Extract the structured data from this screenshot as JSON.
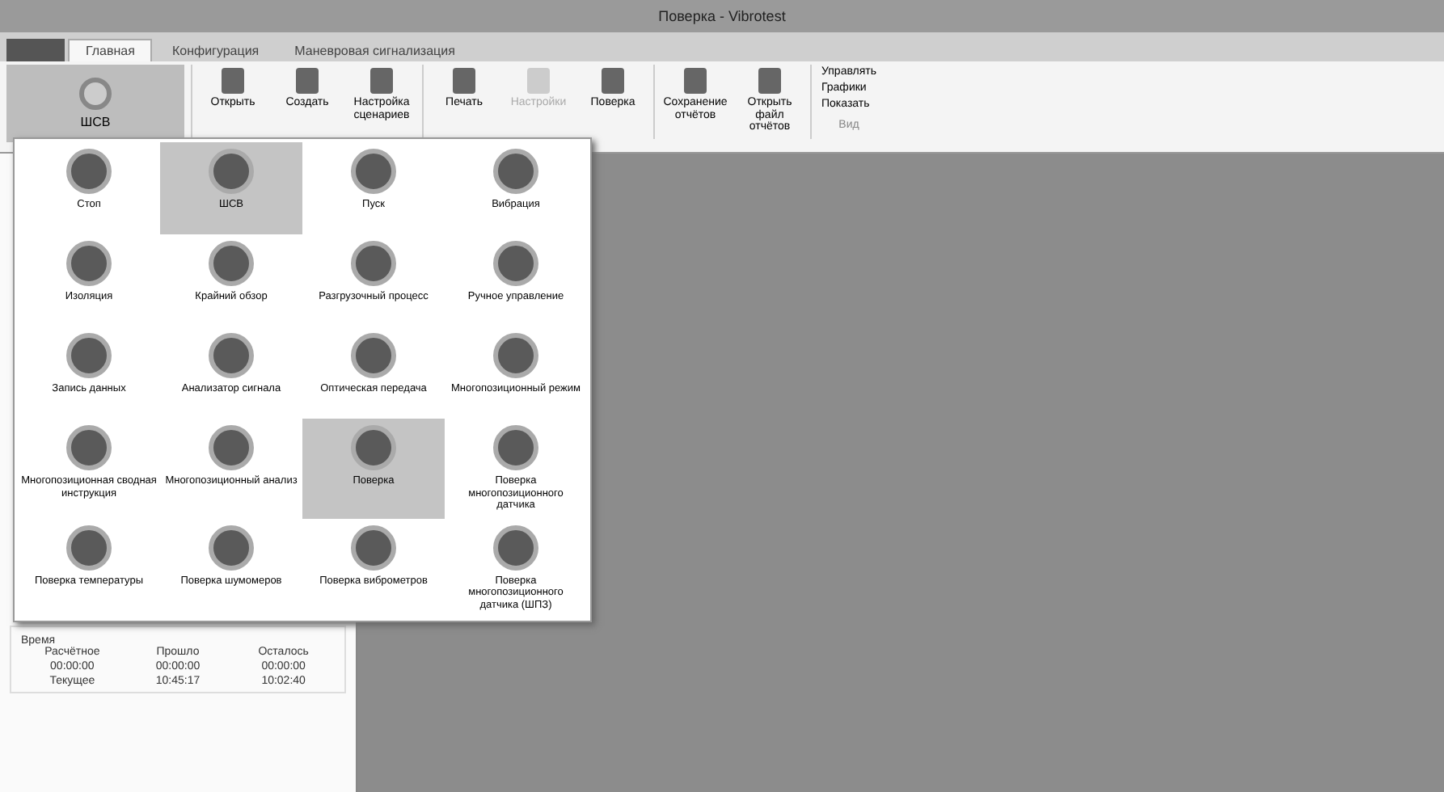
{
  "window": {
    "title": "Поверка - Vibrotest"
  },
  "tabs": [
    {
      "label": "Главная",
      "selected": true
    },
    {
      "label": "Конфигурация",
      "selected": false
    },
    {
      "label": "Маневровая сигнализация",
      "selected": false
    }
  ],
  "mode_button": {
    "label": "ШСВ"
  },
  "ribbon_groups": [
    {
      "buttons": [
        {
          "label": "Открыть",
          "disabled": false
        },
        {
          "label": "Создать",
          "disabled": false
        },
        {
          "label": "Настройка сценариев",
          "disabled": false
        }
      ]
    },
    {
      "buttons": [
        {
          "label": "Печать",
          "disabled": false
        },
        {
          "label": "Настройки",
          "disabled": true
        },
        {
          "label": "Поверка",
          "disabled": false
        }
      ]
    },
    {
      "buttons": [
        {
          "label": "Сохранение отчётов",
          "disabled": false
        },
        {
          "label": "Открыть файл отчётов",
          "disabled": false
        }
      ]
    }
  ],
  "view_menu": {
    "items": [
      "Управлять",
      "Графики",
      "Показать"
    ],
    "group_label": "Вид"
  },
  "modes": [
    {
      "label": "Стоп",
      "selected": false
    },
    {
      "label": "ШСВ",
      "selected": true
    },
    {
      "label": "Пуск",
      "selected": false
    },
    {
      "label": "Вибрация",
      "selected": false
    },
    {
      "label": "Изоляция",
      "selected": false
    },
    {
      "label": "Крайний обзор",
      "selected": false
    },
    {
      "label": "Разгрузочный процесс",
      "selected": false
    },
    {
      "label": "Ручное управление",
      "selected": false
    },
    {
      "label": "Запись данных",
      "selected": false
    },
    {
      "label": "Анализатор сигнала",
      "selected": false
    },
    {
      "label": "Оптическая передача",
      "selected": false
    },
    {
      "label": "Многопозиционный режим",
      "selected": false
    },
    {
      "label": "Многопозиционная сводная инструкция",
      "selected": false
    },
    {
      "label": "Многопозиционный анализ",
      "selected": false
    },
    {
      "label": "Поверка",
      "selected": true
    },
    {
      "label": "Поверка многопозиционного датчика",
      "selected": false
    },
    {
      "label": "Поверка температуры",
      "selected": false
    },
    {
      "label": "Поверка шумомеров",
      "selected": false
    },
    {
      "label": "Поверка виброметров",
      "selected": false
    },
    {
      "label": "Поверка многопозиционного датчика (ШПЗ)",
      "selected": false
    }
  ],
  "time_group": {
    "title": "Время",
    "columns": [
      "Расчётное",
      "Прошло",
      "Осталось"
    ],
    "rows": [
      [
        "00:00:00",
        "00:00:00",
        "00:00:00"
      ],
      [
        "Текущее",
        "10:45:17",
        "10:02:40"
      ]
    ]
  }
}
